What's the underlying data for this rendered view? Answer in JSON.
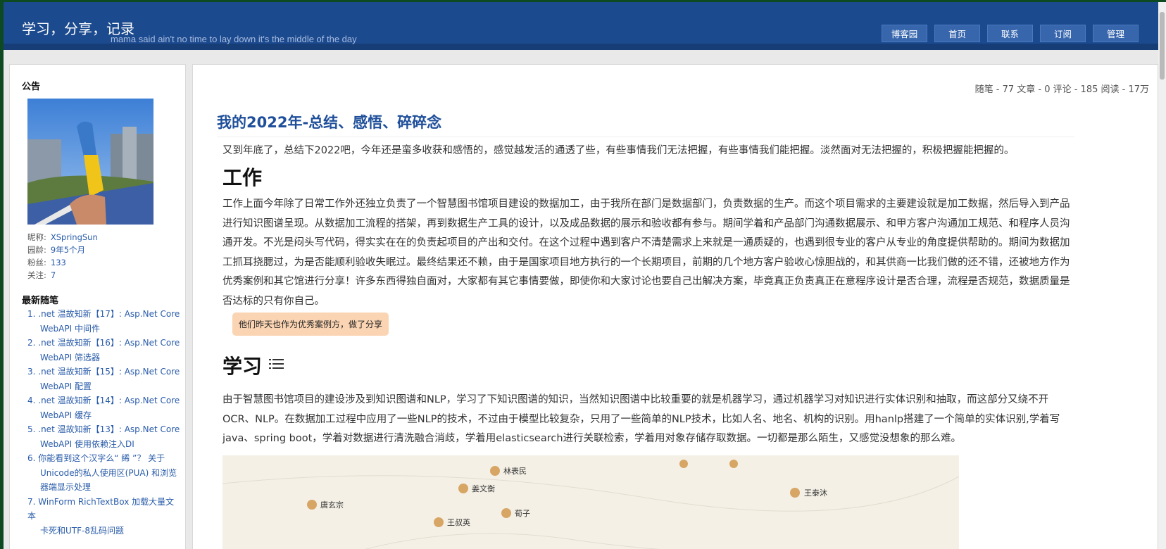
{
  "header": {
    "title": "学习，分享，记录",
    "subtitle": "mama said ain't no time to lay down it's the middle of the day",
    "nav": [
      "博客园",
      "首页",
      "联系",
      "订阅",
      "管理"
    ]
  },
  "sidebar": {
    "notice_title": "公告",
    "profile": {
      "nickname_label": "昵称:",
      "nickname": "XSpringSun",
      "age_label": "园龄:",
      "age": "9年5个月",
      "fans_label": "粉丝:",
      "fans": "133",
      "follow_label": "关注:",
      "follow": "7"
    },
    "recent_title": "最新随笔",
    "recent": [
      {
        "line1": "1. .net 温故知新【17】: Asp.Net Core",
        "line2": "WebAPI 中间件"
      },
      {
        "line1": "2. .net 温故知新【16】: Asp.Net Core",
        "line2": "WebAPI 筛选器"
      },
      {
        "line1": "3. .net 温故知新【15】: Asp.Net Core",
        "line2": "WebAPI 配置"
      },
      {
        "line1": "4. .net 温故知新【14】: Asp.Net Core",
        "line2": "WebAPI 缓存"
      },
      {
        "line1": "5. .net 温故知新【13】: Asp.Net Core",
        "line2": "WebAPI 使用依赖注入DI"
      },
      {
        "line1": "6. 你能看到这个汉字么“ 𫄨 ”？ 关于",
        "line2": "Unicode的私人使用区(PUA) 和浏览",
        "line3": "器端显示处理"
      },
      {
        "line1": "7. WinForm RichTextBox 加载大量文本",
        "line2": "卡死和UTF-8乱码问题"
      }
    ]
  },
  "main": {
    "stats": "随笔 - 77  文章 - 0  评论 - 185  阅读 - 17万",
    "post_title": "我的2022年-总结、感悟、碎碎念",
    "intro": "又到年底了，总结下2022吧，今年还是蛮多收获和感悟的，感觉越发活的通透了些，有些事情我们无法把握，有些事情我们能把握。淡然面对无法把握的，积极把握能把握的。",
    "h_work": "工作",
    "work_text": "工作上面今年除了日常工作外还独立负责了一个智慧图书馆项目建设的数据加工，由于我所在部门是数据部门，负责数据的生产。而这个项目需求的主要建设就是加工数据，然后导入到产品进行知识图谱呈现。从数据加工流程的搭架，再到数据生产工具的设计，以及成品数据的展示和验收都有参与。期间学着和产品部门沟通数据展示、和甲方客户沟通加工规范、和程序人员沟通开发。不光是闷头写代码，得实实在在的负责起项目的产出和交付。在这个过程中遇到客户不清楚需求上来就是一通质疑的，也遇到很专业的客户从专业的角度提供帮助的。期间为数据加工抓耳挠腮过，为是否能顺利验收失眠过。最终结果还不赖，由于是国家项目地方执行的一个长期项目，前期的几个地方客户验收心惊胆战的，和其供商一比我们做的还不错，还被地方作为优秀案例和其它馆进行分享！许多东西得独自面对，大家都有其它事情要做，即使你和大家讨论也要自己出解决方案，毕竟真正负责真正在意程序设计是否合理，流程是否规范，数据质量是否达标的只有你自己。",
    "tip": "他们昨天也作为优秀案例方，做了分享",
    "h_learn": "学习",
    "learn_text": "由于智慧图书馆项目的建设涉及到知识图谱和NLP，学习了下知识图谱的知识，当然知识图谱中比较重要的就是机器学习，通过机器学习对知识进行实体识别和抽取，而这部分又绕不开OCR、NLP。在数据加工过程中应用了一些NLP的技术，不过由于模型比较复杂，只用了一些简单的NLP技术，比如人名、地名、机构的识别。用hanlp搭建了一个简单的实体识别,学着写java、spring boot，学着对数据进行清洗融合消歧，学着用elasticsearch进行关联检索，学着用对象存储存取数据。一切都是那么陌生，又感觉没想象的那么难。",
    "graph_nodes": [
      "林表民",
      "姜文衡",
      "唐玄宗",
      "荀子",
      "王叔英",
      "王泰沐"
    ]
  }
}
